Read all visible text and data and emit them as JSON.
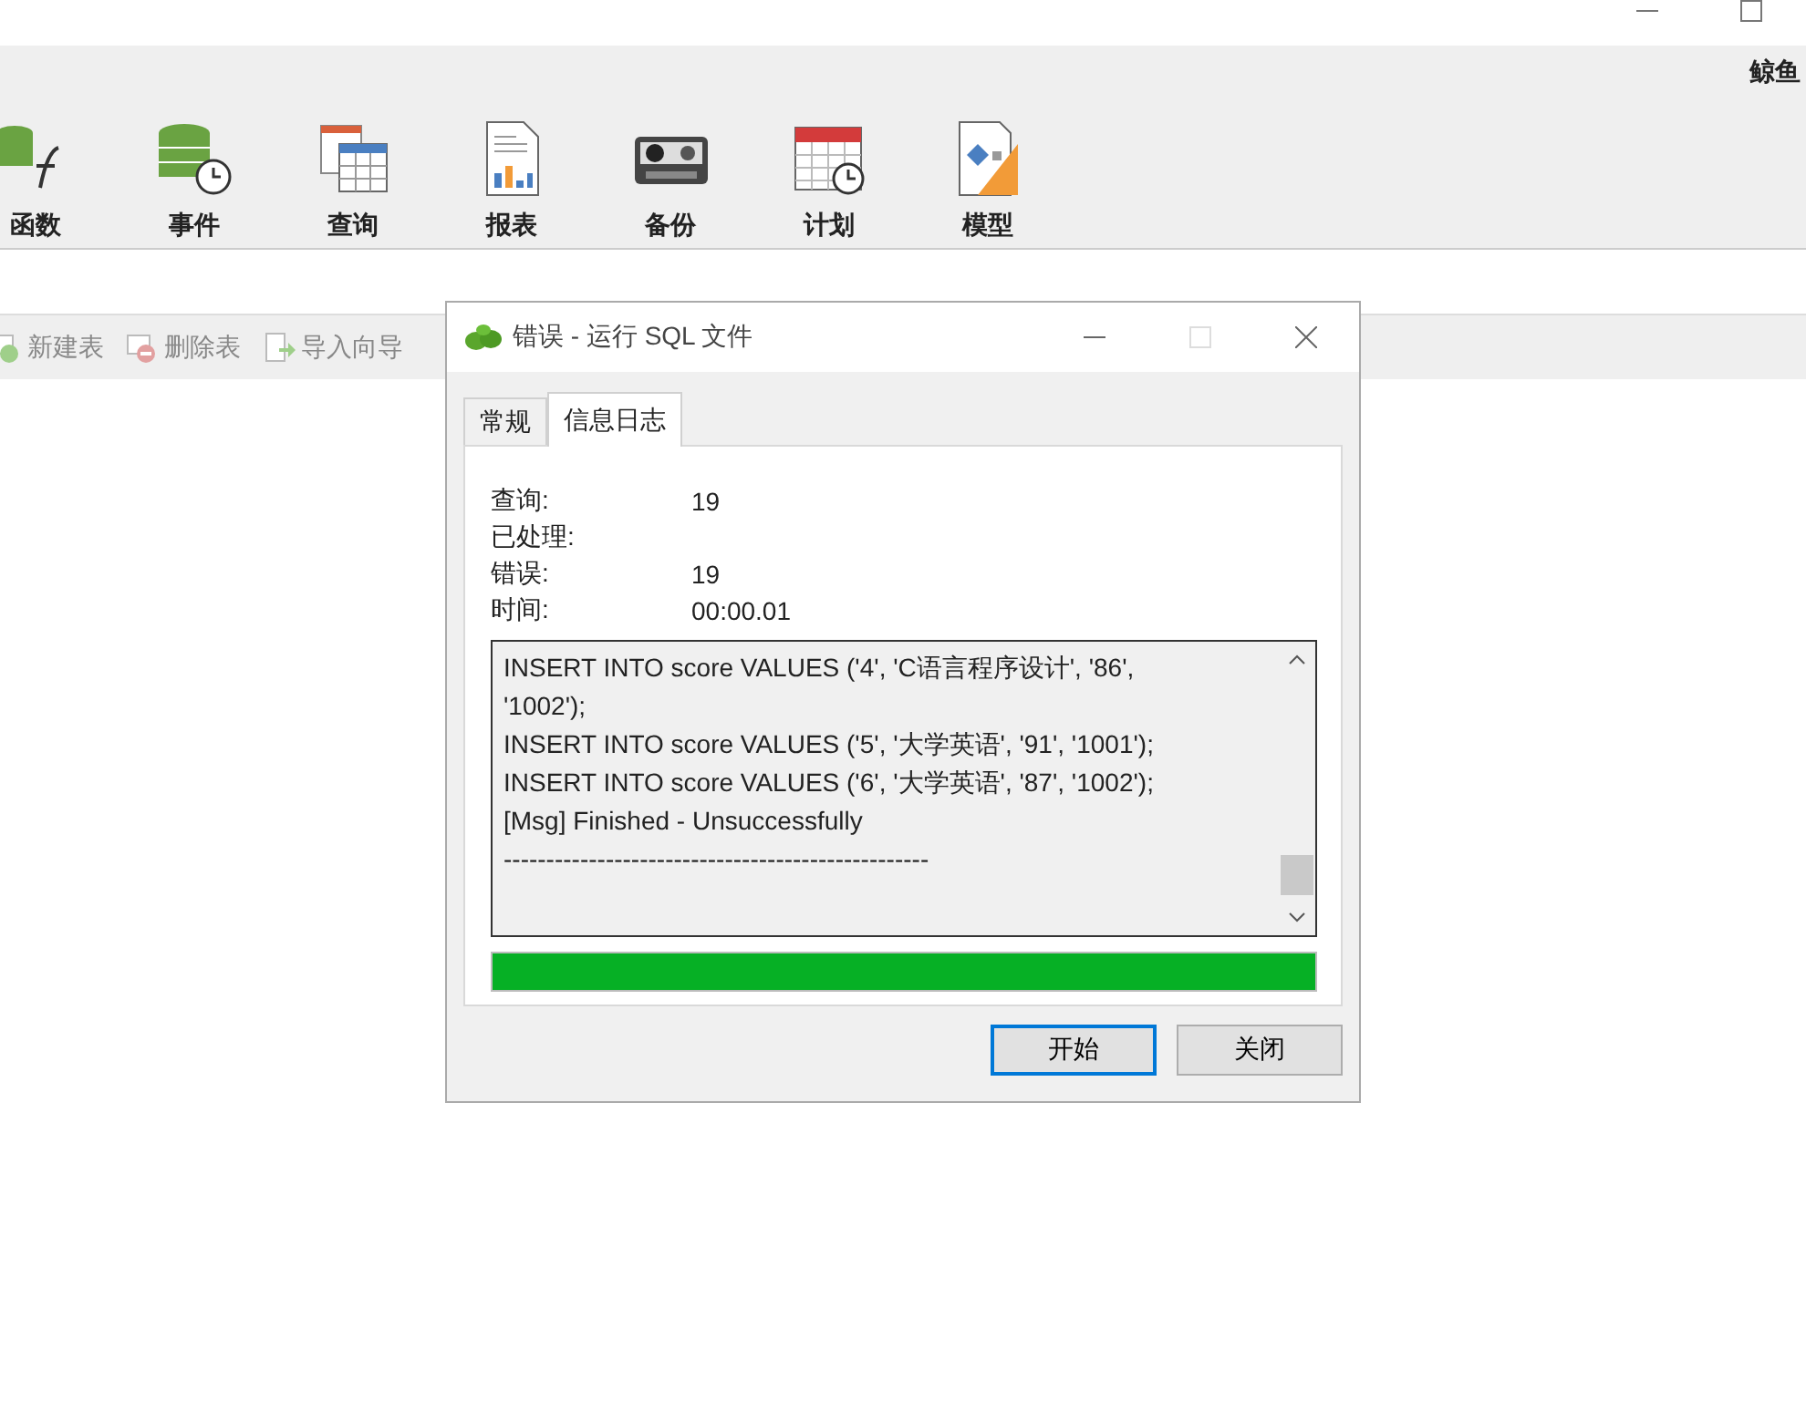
{
  "user": "鲸鱼",
  "ribbon": [
    {
      "label": "函数",
      "kind": "function"
    },
    {
      "label": "事件",
      "kind": "event"
    },
    {
      "label": "查询",
      "kind": "query"
    },
    {
      "label": "报表",
      "kind": "report"
    },
    {
      "label": "备份",
      "kind": "backup"
    },
    {
      "label": "计划",
      "kind": "schedule"
    },
    {
      "label": "模型",
      "kind": "model"
    }
  ],
  "toolbar": [
    {
      "label": "新建表",
      "kind": "new"
    },
    {
      "label": "删除表",
      "kind": "delete"
    },
    {
      "label": "导入向导",
      "kind": "import"
    }
  ],
  "dialog": {
    "title": "错误 - 运行 SQL 文件",
    "tabs": [
      {
        "label": "常规",
        "selected": false
      },
      {
        "label": "信息日志",
        "selected": true
      }
    ],
    "stats": [
      {
        "label": "查询:",
        "value": "19"
      },
      {
        "label": "已处理:"
      },
      {
        "label": "错误:",
        "value": "19"
      },
      {
        "label": "时间:",
        "value": "00:00.01"
      }
    ],
    "log": [
      "INSERT INTO score VALUES ('4', 'C语言程序设计', '86',",
      "'1002');",
      "INSERT INTO score VALUES ('5', '大学英语', '91', '1001');",
      "INSERT INTO score VALUES ('6', '大学英语', '87', '1002');",
      "[Msg] Finished - Unsuccessfully",
      "--------------------------------------------------"
    ],
    "progress": {
      "level": 1
    },
    "buttons": [
      {
        "label": "开始",
        "selected": true
      },
      {
        "label": "关闭",
        "selected": false
      }
    ]
  }
}
